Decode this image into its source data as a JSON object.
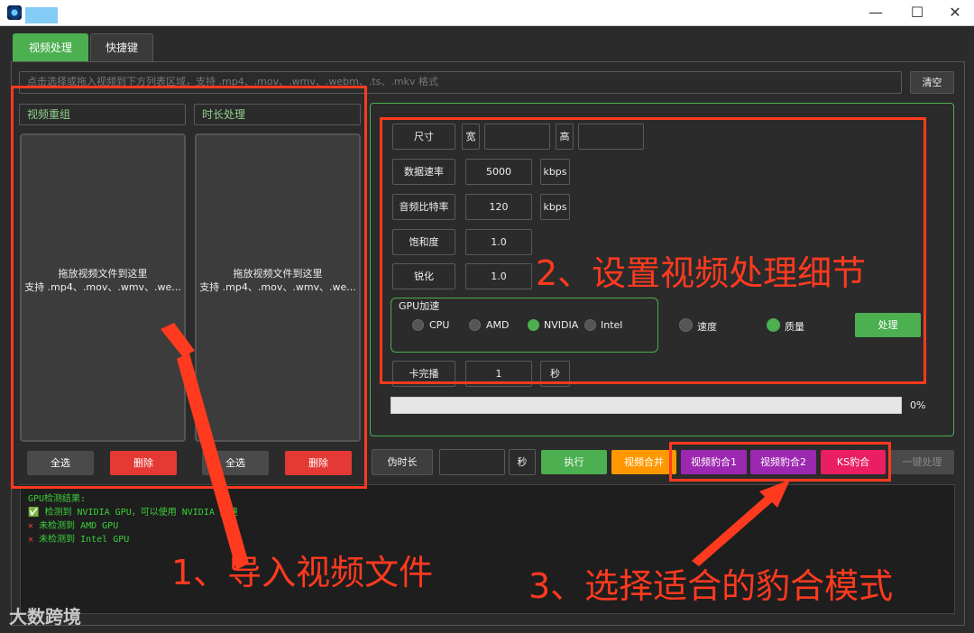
{
  "window": {
    "minimize": "—",
    "maximize": "☐",
    "close": "✕"
  },
  "tabs": [
    {
      "label": "视频处理"
    },
    {
      "label": "快捷键"
    }
  ],
  "top": {
    "drop_placeholder": "点击选择或拖入视频到下方列表区域，支持 .mp4、.mov、.wmv、.webm、.ts、.mkv 格式",
    "clear_label": "清空"
  },
  "left": {
    "col1_title": "视频重组",
    "col2_title": "时长处理",
    "drop_line1": "拖放视频文件到这里",
    "drop_line2": "支持 .mp4、.mov、.wmv、.we...",
    "select_all": "全选",
    "delete": "删除"
  },
  "settings": {
    "size_label": "尺寸",
    "width_label": "宽",
    "height_label": "高",
    "bitrate_label": "数据速率",
    "bitrate_value": "5000",
    "bitrate_unit": "kbps",
    "audio_label": "音频比特率",
    "audio_value": "120",
    "audio_unit": "kbps",
    "saturation_label": "饱和度",
    "saturation_value": "1.0",
    "sharpen_label": "锐化",
    "sharpen_value": "1.0",
    "gpu_title": "GPU加速",
    "gpu_options": [
      "CPU",
      "AMD",
      "NVIDIA",
      "Intel"
    ],
    "gpu_selected": "NVIDIA",
    "speed_label": "速度",
    "quality_label": "质量",
    "process_label": "处理",
    "stutter_label": "卡完播",
    "stutter_value": "1",
    "stutter_unit": "秒",
    "progress_percent": 0,
    "progress_text": "0%"
  },
  "actions": {
    "fake_duration": "伪时长",
    "seconds": "秒",
    "execute": "执行",
    "merge": "视频合并",
    "leopard1": "视频豹合1",
    "leopard2": "视频豹合2",
    "ks_leopard": "KS豹合",
    "one_click": "一键处理"
  },
  "log": {
    "title": "GPU检测结果:",
    "lines": [
      {
        "icon": "✅",
        "text": "检测到 NVIDIA GPU，可以使用 NVIDIA 加速"
      },
      {
        "icon": "✕",
        "text": "未检测到 AMD GPU"
      },
      {
        "icon": "✕",
        "text": "未检测到 Intel GPU"
      }
    ]
  },
  "annotations": {
    "a1": "1、导入视频文件",
    "a2": "2、设置视频处理细节",
    "a3": "3、选择适合的豹合模式"
  },
  "watermark": "大数跨境",
  "colors": {
    "accent": "#4caf50",
    "annotation": "#ff3a1f",
    "danger": "#e53935",
    "merge": "#ff9800",
    "purple": "#9c27b0",
    "pink": "#e91e63"
  }
}
